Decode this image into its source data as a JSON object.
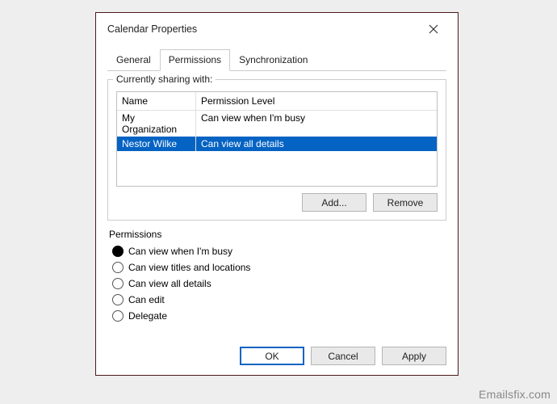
{
  "window": {
    "title": "Calendar Properties"
  },
  "tabs": [
    {
      "label": "General",
      "active": false
    },
    {
      "label": "Permissions",
      "active": true
    },
    {
      "label": "Synchronization",
      "active": false
    }
  ],
  "sharing": {
    "legend": "Currently sharing with:",
    "columns": {
      "name": "Name",
      "perm": "Permission Level"
    },
    "rows": [
      {
        "name": "My Organization",
        "perm": "Can view when I'm busy",
        "selected": false
      },
      {
        "name": "Nestor Wilke",
        "perm": "Can view all details",
        "selected": true
      }
    ],
    "add_label": "Add...",
    "remove_label": "Remove"
  },
  "permissions": {
    "legend": "Permissions",
    "options": [
      {
        "label": "Can view when I'm busy",
        "selected": true
      },
      {
        "label": "Can view titles and locations",
        "selected": false
      },
      {
        "label": "Can view all details",
        "selected": false
      },
      {
        "label": "Can edit",
        "selected": false
      },
      {
        "label": "Delegate",
        "selected": false
      }
    ]
  },
  "footer": {
    "ok": "OK",
    "cancel": "Cancel",
    "apply": "Apply"
  },
  "watermark": "Emailsfix.com"
}
